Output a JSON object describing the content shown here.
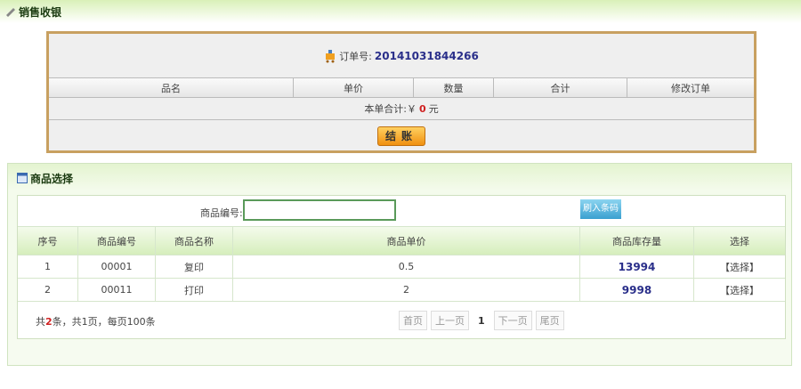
{
  "header": {
    "title": "销售收银"
  },
  "order": {
    "order_no_label": "订单号:",
    "order_no": "20141031844266",
    "columns": [
      "品名",
      "单价",
      "数量",
      "合计",
      "修改订单"
    ],
    "total_label": "本单合计:￥",
    "total_value": "0",
    "total_unit": "元",
    "checkout_label": "结账"
  },
  "goods": {
    "title": "商品选择",
    "search_label": "商品编号:",
    "search_value": "",
    "scan_button": "刷入条码",
    "columns": [
      "序号",
      "商品编号",
      "商品名称",
      "商品单价",
      "商品库存量",
      "选择"
    ],
    "rows": [
      {
        "no": "1",
        "code": "00001",
        "name": "复印",
        "price": "0.5",
        "stock": "13994",
        "select": "【选择】"
      },
      {
        "no": "2",
        "code": "00011",
        "name": "打印",
        "price": "2",
        "stock": "9998",
        "select": "【选择】"
      }
    ],
    "pagination": {
      "prefix": "共",
      "count": "2",
      "suffix": "条，共1页，每页100条",
      "first": "首页",
      "prev": "上一页",
      "current": "1",
      "next": "下一页",
      "last": "尾页"
    }
  }
}
